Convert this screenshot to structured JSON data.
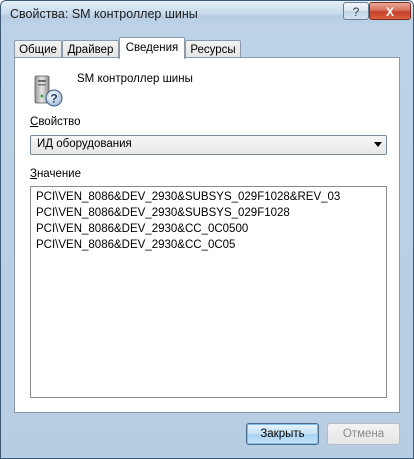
{
  "window": {
    "title": "Свойства: SM контроллер шины",
    "help_label": "?",
    "close_label": "X"
  },
  "tabs": [
    {
      "label": "Общие",
      "active": false
    },
    {
      "label": "Драйвер",
      "active": false
    },
    {
      "label": "Сведения",
      "active": true
    },
    {
      "label": "Ресурсы",
      "active": false
    }
  ],
  "details": {
    "device_name": "SM контроллер шины",
    "device_icon": "unknown-device-icon",
    "property_label": "Свойство",
    "property_mnemonic": "С",
    "property_rest": "войство",
    "property_value": "ИД оборудования",
    "value_label": "Значение",
    "value_mnemonic": "З",
    "value_rest": "начение",
    "values": [
      "PCI\\VEN_8086&DEV_2930&SUBSYS_029F1028&REV_03",
      "PCI\\VEN_8086&DEV_2930&SUBSYS_029F1028",
      "PCI\\VEN_8086&DEV_2930&CC_0C0500",
      "PCI\\VEN_8086&DEV_2930&CC_0C05"
    ]
  },
  "buttons": {
    "ok_label": "Закрыть",
    "cancel_label": "Отмена"
  },
  "colors": {
    "titlebar": "#c8dbec",
    "close_button": "#c5402a",
    "default_button": "#a9d3f2"
  }
}
